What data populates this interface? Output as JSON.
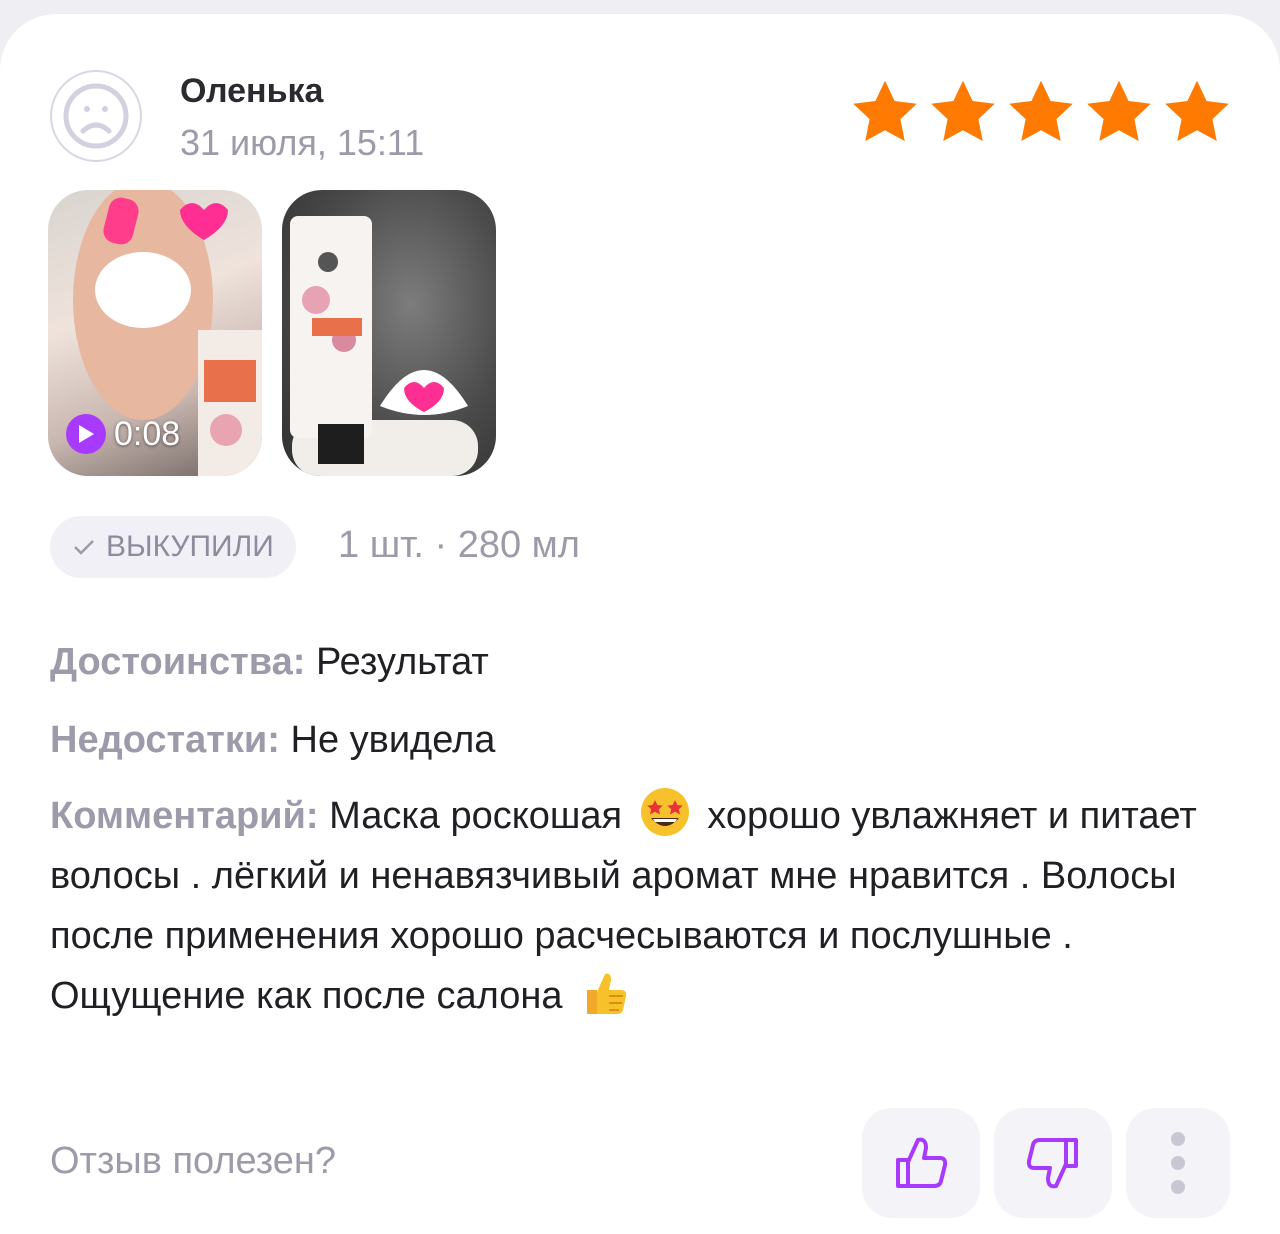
{
  "review": {
    "author": "Оленька",
    "date": "31 июля, 15:11",
    "rating": 5,
    "star_color": "#ff7a00",
    "media": [
      {
        "type": "video",
        "duration": "0:08"
      },
      {
        "type": "photo"
      }
    ],
    "badge": "ВЫКУПИЛИ",
    "variant": "1 шт. · 280 мл",
    "pros_label": "Достоинства:",
    "pros_text": "Результат",
    "cons_label": "Недостатки:",
    "cons_text": "Не увидела",
    "comment_label": "Комментарий:",
    "comment_part1": "Маска роскошая",
    "comment_part2": "хорошо увлажняет и питает волосы . лёгкий и ненавязчивый аромат мне нравится . Волосы после применения хорошо расчесываются и послушные . Ощущение как после салона",
    "emoji1": "star-struck-emoji",
    "emoji2": "thumbs-up-emoji"
  },
  "footer": {
    "question": "Отзыв полезен?",
    "accent": "#a73afd"
  }
}
